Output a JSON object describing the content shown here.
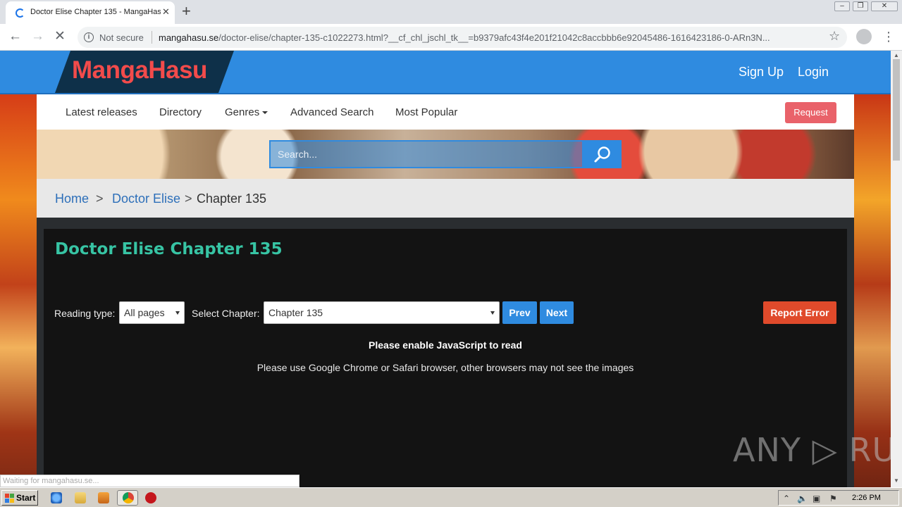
{
  "browser": {
    "tab_title": "Doctor Elise Chapter 135 - MangaHasu",
    "tab_close": "✕",
    "new_tab": "+",
    "security": "Not secure",
    "url_host": "mangahasu.se",
    "url_path": "/doctor-elise/chapter-135-c1022273.html?__cf_chl_jschl_tk__=b9379afc43f4e201f21042c8accbbb6e92045486-1616423186-0-ARn3N...",
    "status_text": "Waiting for mangahasu.se..."
  },
  "site": {
    "logo": "MangaHasu",
    "signup": "Sign Up",
    "login": "Login",
    "nav": [
      "Latest releases",
      "Directory",
      "Genres",
      "Advanced Search",
      "Most Popular"
    ],
    "request": "Request",
    "search_placeholder": "Search..."
  },
  "breadcrumb": {
    "home": "Home",
    "series": "Doctor Elise",
    "current": "Chapter 135",
    "separator": ">"
  },
  "reader": {
    "title": "Doctor Elise Chapter 135",
    "reading_type_label": "Reading type:",
    "reading_type_value": "All pages",
    "chapter_label": "Select Chapter:",
    "chapter_value": "Chapter 135",
    "prev": "Prev",
    "next": "Next",
    "report": "Report Error",
    "notice_js": "Please enable JavaScript to read",
    "notice_browser": "Please use Google Chrome or Safari browser, other browsers may not see the images"
  },
  "watermark": "ANY ▷ RUN",
  "taskbar": {
    "start": "Start",
    "clock": "2:26 PM"
  },
  "colors": {
    "header_blue": "#2f8be0",
    "title_teal": "#37c4a4",
    "report_red": "#e04a2b",
    "request_pink": "#e9626a"
  }
}
